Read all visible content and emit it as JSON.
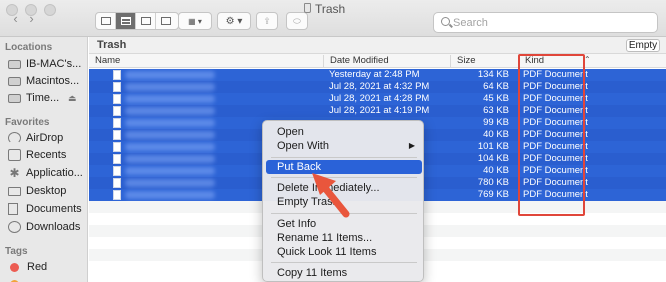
{
  "window": {
    "title": "Trash"
  },
  "search": {
    "placeholder": "Search",
    "value": ""
  },
  "sidebar": {
    "locations_header": "Locations",
    "locations": [
      {
        "label": "IB-MAC's...",
        "icon": "laptop-icon"
      },
      {
        "label": "Macintos...",
        "icon": "disk-icon"
      },
      {
        "label": "Time...",
        "icon": "time-machine-icon"
      }
    ],
    "favorites_header": "Favorites",
    "favorites": [
      {
        "label": "AirDrop",
        "icon": "airdrop-icon"
      },
      {
        "label": "Recents",
        "icon": "recents-icon"
      },
      {
        "label": "Applicatio...",
        "icon": "applications-icon"
      },
      {
        "label": "Desktop",
        "icon": "desktop-icon"
      },
      {
        "label": "Documents",
        "icon": "documents-icon"
      },
      {
        "label": "Downloads",
        "icon": "downloads-icon"
      }
    ],
    "tags_header": "Tags",
    "tags": [
      {
        "label": "Red",
        "color": "#ec5c52"
      }
    ]
  },
  "main": {
    "folder_name": "Trash",
    "empty_button": "Empty",
    "columns": {
      "name": "Name",
      "date": "Date Modified",
      "size": "Size",
      "kind": "Kind"
    },
    "files": [
      {
        "date": "Yesterday at 2:48 PM",
        "size": "134 KB",
        "kind": "PDF Document"
      },
      {
        "date": "Jul 28, 2021 at 4:32 PM",
        "size": "64 KB",
        "kind": "PDF Document"
      },
      {
        "date": "Jul 28, 2021 at 4:28 PM",
        "size": "45 KB",
        "kind": "PDF Document"
      },
      {
        "date": "Jul 28, 2021 at 4:19 PM",
        "size": "63 KB",
        "kind": "PDF Document"
      },
      {
        "date": "",
        "size": "99 KB",
        "kind": "PDF Document"
      },
      {
        "date": "",
        "size": "40 KB",
        "kind": "PDF Document"
      },
      {
        "date": "",
        "size": "101 KB",
        "kind": "PDF Document"
      },
      {
        "date": "",
        "size": "104 KB",
        "kind": "PDF Document"
      },
      {
        "date": "",
        "size": "40 KB",
        "kind": "PDF Document"
      },
      {
        "date": "",
        "size": "780 KB",
        "kind": "PDF Document"
      },
      {
        "date": "",
        "size": "769 KB",
        "kind": "PDF Document"
      }
    ]
  },
  "context_menu": {
    "open": "Open",
    "open_with": "Open With",
    "put_back": "Put Back",
    "delete_immediately": "Delete Immediately...",
    "empty_trash": "Empty Trash",
    "get_info": "Get Info",
    "rename": "Rename 11 Items...",
    "quick_look": "Quick Look 11 Items",
    "copy": "Copy 11 Items"
  },
  "colors": {
    "selection": "#2d64d6",
    "highlight_box": "#e0463a",
    "arrow": "#e9563c"
  }
}
